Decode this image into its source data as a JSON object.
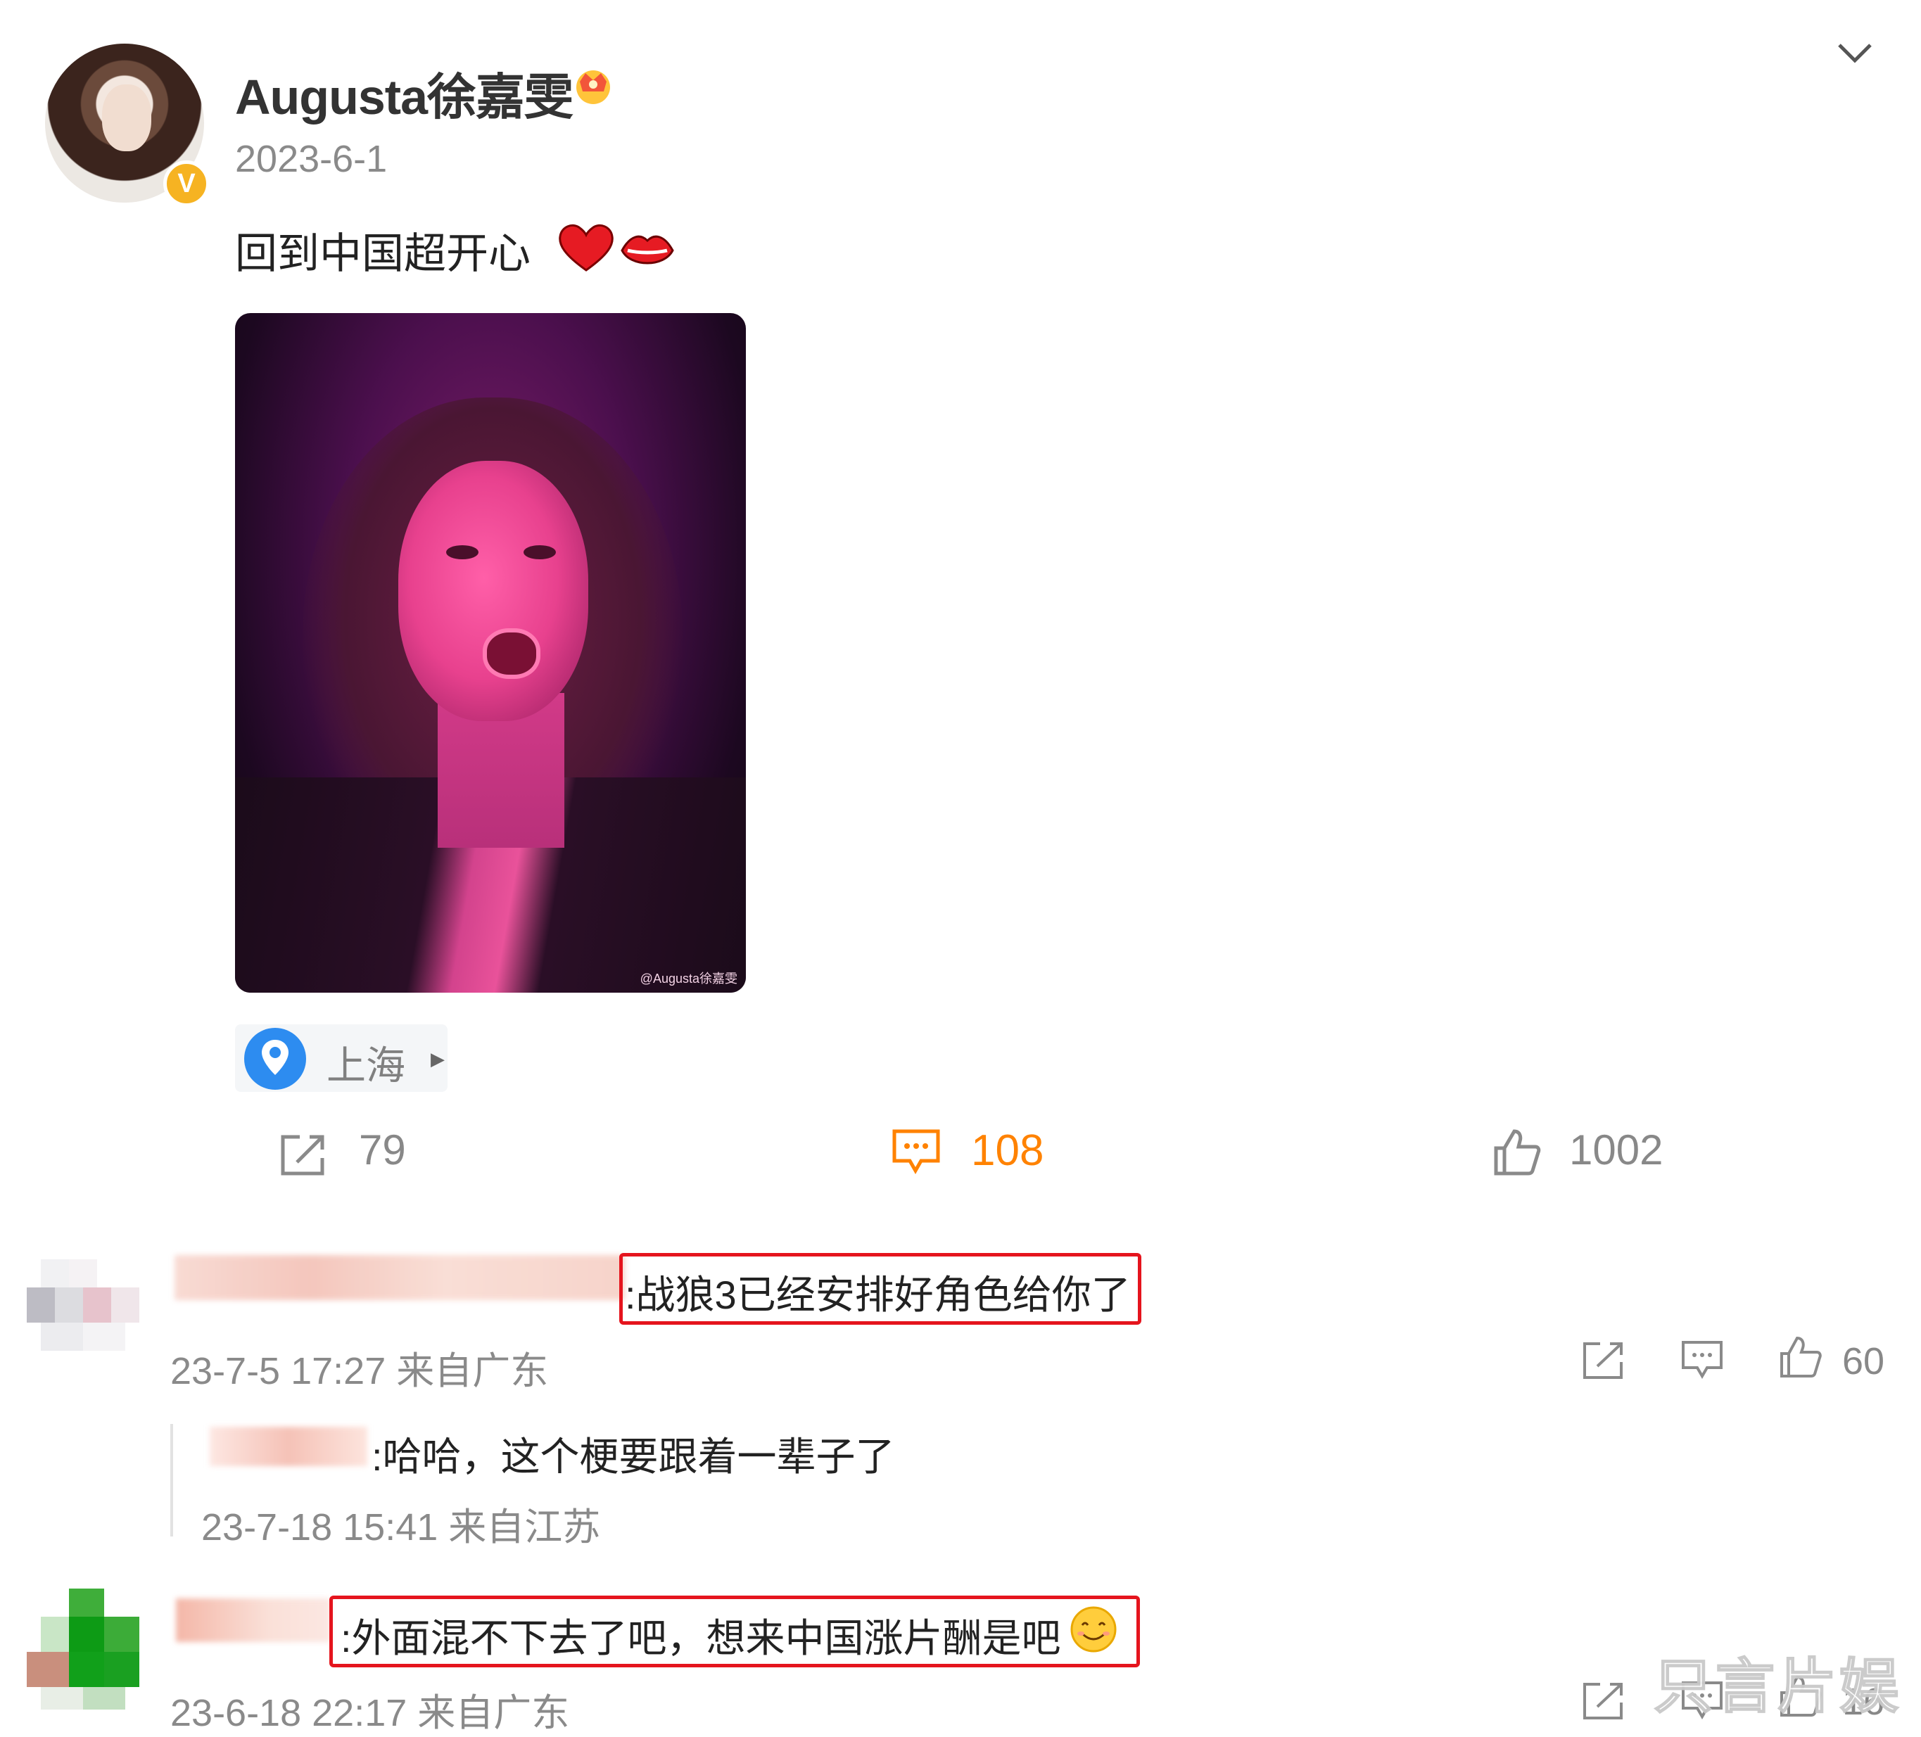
{
  "post": {
    "username": "Augusta徐嘉雯",
    "date": "2023-6-1",
    "text": "回到中国超开心",
    "image_watermark": "@Augusta徐嘉雯",
    "location": "上海",
    "stats": {
      "shares": "79",
      "comments": "108",
      "likes": "1002"
    }
  },
  "colors": {
    "accent": "#ff8200",
    "highlight": "#e5141d",
    "verified": "#f6b322",
    "location_icon": "#2d8cf0"
  },
  "icons": [
    "avatar",
    "verified-icon",
    "crown-icon",
    "chevron-down-icon",
    "heart-emoji",
    "lips-emoji",
    "location-pin-icon",
    "share-icon",
    "comment-icon",
    "like-icon",
    "smile-emoji"
  ],
  "comments": [
    {
      "text": ":战狼3已经安排好角色给你了",
      "meta": "23-7-5 17:27 来自广东",
      "likes": "60",
      "reply": {
        "text": ":哈哈，这个梗要跟着一辈子了",
        "meta": "23-7-18 15:41 来自江苏"
      }
    },
    {
      "text": ":外面混不下去了吧，想来中国涨片酬是吧",
      "meta": "23-6-18 22:17 来自广东",
      "likes": "16"
    }
  ],
  "watermark": "只言片娱"
}
